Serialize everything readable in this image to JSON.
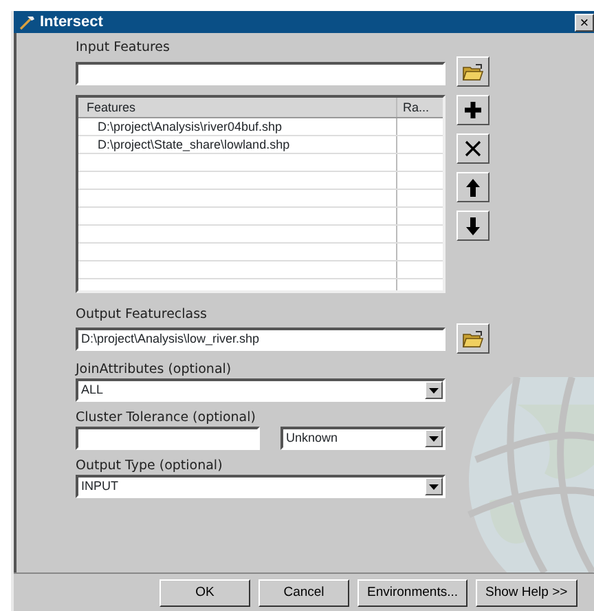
{
  "window": {
    "title": "Intersect",
    "close": "×"
  },
  "input_features": {
    "label": "Input Features"
  },
  "features_table": {
    "columns": [
      "Features",
      "Ra..."
    ],
    "rows": [
      {
        "path": "D:\\project\\Analysis\\river04buf.shp"
      },
      {
        "path": "D:\\project\\State_share\\lowland.shp"
      }
    ]
  },
  "output_featureclass": {
    "label": "Output Featureclass",
    "value": "D:\\project\\Analysis\\low_river.shp"
  },
  "join_attributes": {
    "label": "JoinAttributes (optional)",
    "value": "ALL"
  },
  "cluster_tolerance": {
    "label": "Cluster Tolerance (optional)",
    "unit": "Unknown"
  },
  "output_type": {
    "label": "Output Type (optional)",
    "value": "INPUT"
  },
  "buttons": [
    "OK",
    "Cancel",
    "Environments...",
    "Show Help >>"
  ]
}
